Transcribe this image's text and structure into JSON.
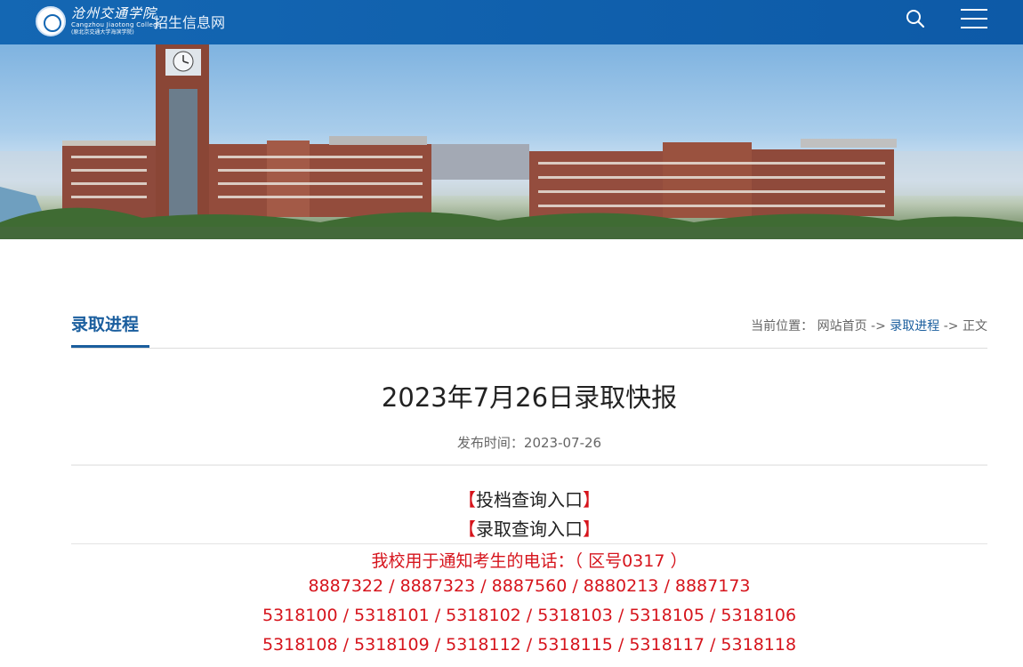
{
  "header": {
    "logo_cn": "沧州交通学院",
    "logo_en": "Cangzhou Jiaotong College",
    "logo_sub": "(原北京交通大学海滨学院)",
    "site_name": "招生信息网"
  },
  "section": {
    "title": "录取进程"
  },
  "breadcrumb": {
    "prefix": "当前位置：",
    "home": "网站首页",
    "sep": "->",
    "current": "录取进程",
    "last": "正文"
  },
  "article": {
    "title": "2023年7月26日录取快报",
    "pub_label": "发布时间：",
    "pub_date": "2023-07-26",
    "links": [
      {
        "open": "【",
        "label": "投档查询入口",
        "close": "】"
      },
      {
        "open": "【",
        "label": "录取查询入口",
        "close": "】"
      }
    ],
    "phone_intro": "我校用于通知考生的电话：（ 区号0317 ）",
    "phone_lines": [
      "8887322 / 8887323 / 8887560 / 8880213 / 8887173",
      "5318100 / 5318101 / 5318102 / 5318103 / 5318105 / 5318106",
      "5318108 / 5318109 / 5318112 / 5318115 / 5318117 / 5318118"
    ]
  },
  "colors": {
    "header_bg": "#1467b3",
    "accent": "#1a5e9e",
    "red": "#d6141c"
  }
}
